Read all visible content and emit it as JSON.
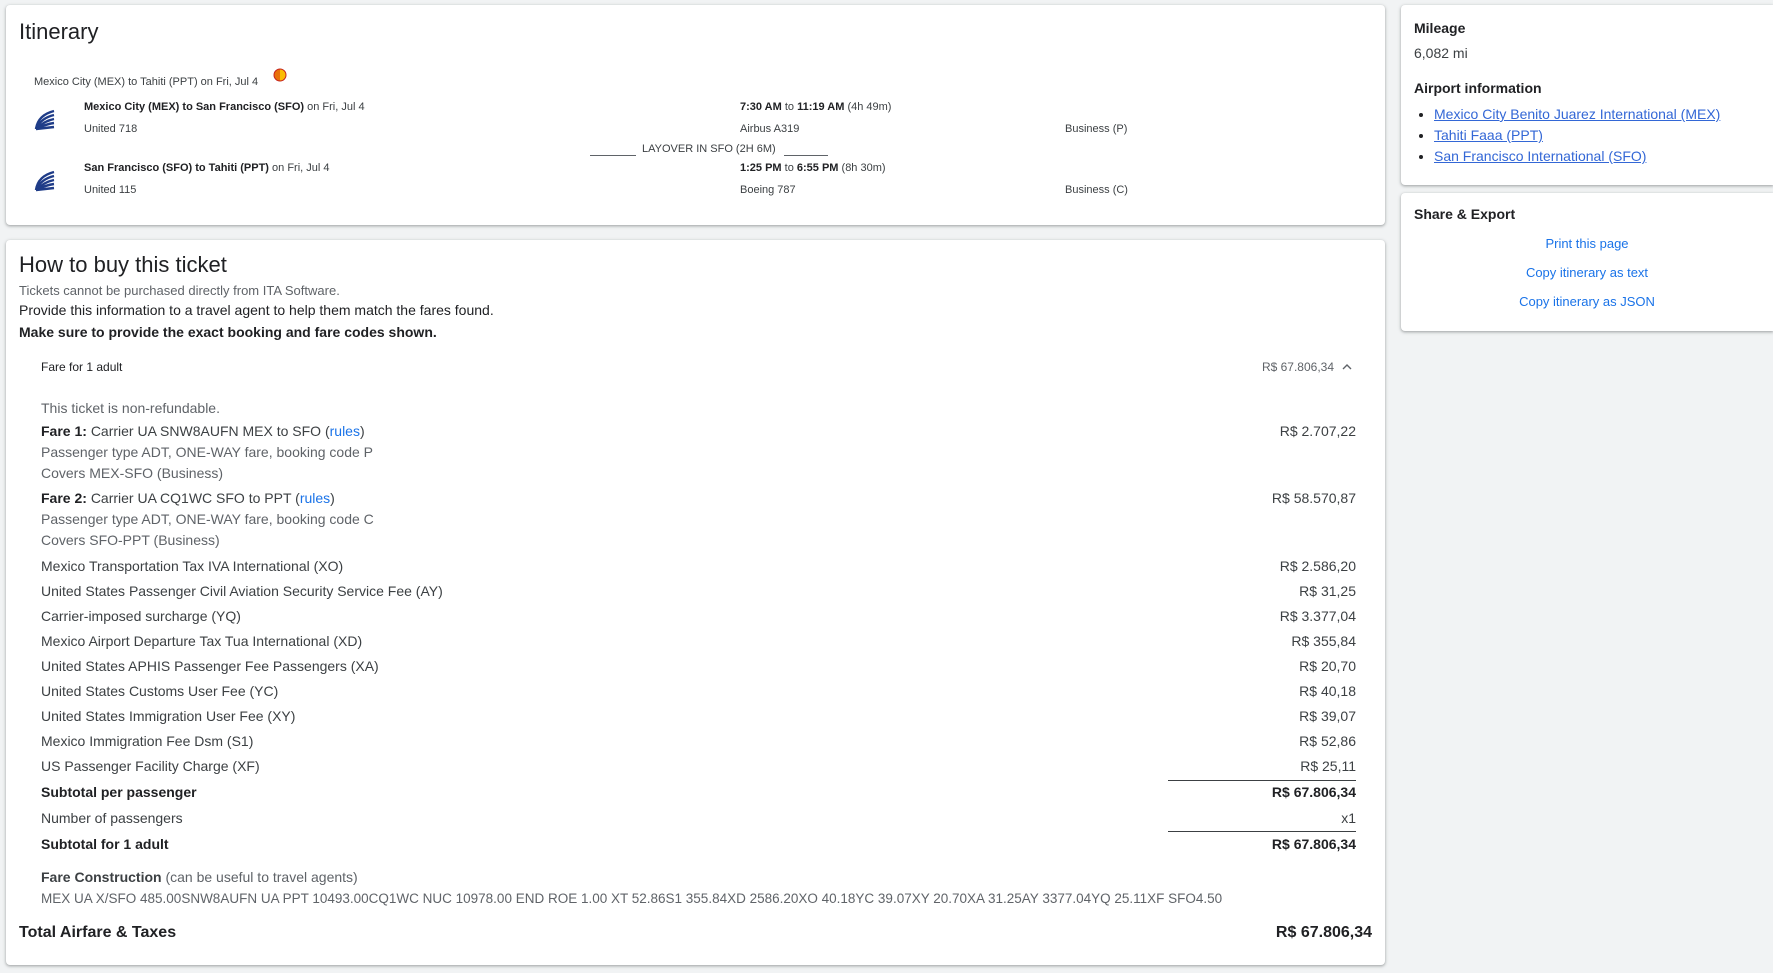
{
  "itinerary": {
    "title": "Itinerary",
    "trip_summary": "Mexico City (MEX) to Tahiti (PPT) on Fri, Jul 4",
    "layover": "LAYOVER IN SFO (2H 6M)",
    "segments": [
      {
        "route": "Mexico City (MEX) to San Francisco (SFO)",
        "date": "on Fri, Jul 4",
        "flight": "United 718",
        "dep": "7:30 AM",
        "to": "to",
        "arr": "11:19 AM",
        "duration": "(4h 49m)",
        "aircraft": "Airbus A319",
        "cabin": "Business (P)"
      },
      {
        "route": "San Francisco (SFO) to Tahiti (PPT)",
        "date": "on Fri, Jul 4",
        "flight": "United 115",
        "dep": "1:25 PM",
        "to": "to",
        "arr": "6:55 PM",
        "duration": "(8h 30m)",
        "aircraft": "Boeing 787",
        "cabin": "Business (C)"
      }
    ]
  },
  "buy": {
    "title": "How to buy this ticket",
    "note": "Tickets cannot be purchased directly from ITA Software.",
    "line1": "Provide this information to a travel agent to help them match the fares found.",
    "line2": "Make sure to provide the exact booking and fare codes shown.",
    "fare_header": "Fare for 1 adult",
    "fare_header_amount": "R$ 67.806,34",
    "non_refundable": "This ticket is non-refundable.",
    "fares": [
      {
        "label": "Fare 1:",
        "desc": "Carrier UA SNW8AUFN MEX to SFO (",
        "rules": "rules",
        "close": ")",
        "amount": "R$ 2.707,22",
        "detail1": "Passenger type ADT, ONE-WAY fare, booking code P",
        "detail2": "Covers MEX-SFO (Business)"
      },
      {
        "label": "Fare 2:",
        "desc": "Carrier UA CQ1WC SFO to PPT (",
        "rules": "rules",
        "close": ")",
        "amount": "R$ 58.570,87",
        "detail1": "Passenger type ADT, ONE-WAY fare, booking code C",
        "detail2": "Covers SFO-PPT (Business)"
      }
    ],
    "taxes": [
      {
        "name": "Mexico Transportation Tax IVA International (XO)",
        "amount": "R$ 2.586,20"
      },
      {
        "name": "United States Passenger Civil Aviation Security Service Fee (AY)",
        "amount": "R$ 31,25"
      },
      {
        "name": "Carrier-imposed surcharge (YQ)",
        "amount": "R$ 3.377,04"
      },
      {
        "name": "Mexico Airport Departure Tax Tua International (XD)",
        "amount": "R$ 355,84"
      },
      {
        "name": "United States APHIS Passenger Fee Passengers (XA)",
        "amount": "R$ 20,70"
      },
      {
        "name": "United States Customs User Fee (YC)",
        "amount": "R$ 40,18"
      },
      {
        "name": "United States Immigration User Fee (XY)",
        "amount": "R$ 39,07"
      },
      {
        "name": "Mexico Immigration Fee Dsm (S1)",
        "amount": "R$ 52,86"
      },
      {
        "name": "US Passenger Facility Charge (XF)",
        "amount": "R$ 25,11"
      }
    ],
    "subtotal_pp_label": "Subtotal per passenger",
    "subtotal_pp_amount": "R$ 67.806,34",
    "passengers_label": "Number of passengers",
    "passengers_value": "x1",
    "subtotal_adult_label": "Subtotal for 1 adult",
    "subtotal_adult_amount": "R$ 67.806,34",
    "fare_construction_label": "Fare Construction",
    "fare_construction_note": "(can be useful to travel agents)",
    "fare_construction": "MEX UA X/SFO 485.00SNW8AUFN UA PPT 10493.00CQ1WC NUC 10978.00 END ROE 1.00 XT 52.86S1 355.84XD 2586.20XO 40.18YC 39.07XY 20.70XA 31.25AY 3377.04YQ 25.11XF SFO4.50",
    "total_label": "Total Airfare & Taxes",
    "total_amount": "R$ 67.806,34"
  },
  "sidebar": {
    "mileage_label": "Mileage",
    "mileage_value": "6,082 mi",
    "airport_label": "Airport information",
    "airports": [
      "Mexico City Benito Juarez International (MEX)",
      "Tahiti Faaa (PPT)",
      "San Francisco International (SFO)"
    ],
    "share_label": "Share & Export",
    "print": "Print this page",
    "copy_text": "Copy itinerary as text",
    "copy_json": "Copy itinerary as JSON"
  },
  "colors": {
    "accent": "#1a73e8",
    "united_blue": "#1f3c88",
    "night_icon": "#e8710a"
  }
}
